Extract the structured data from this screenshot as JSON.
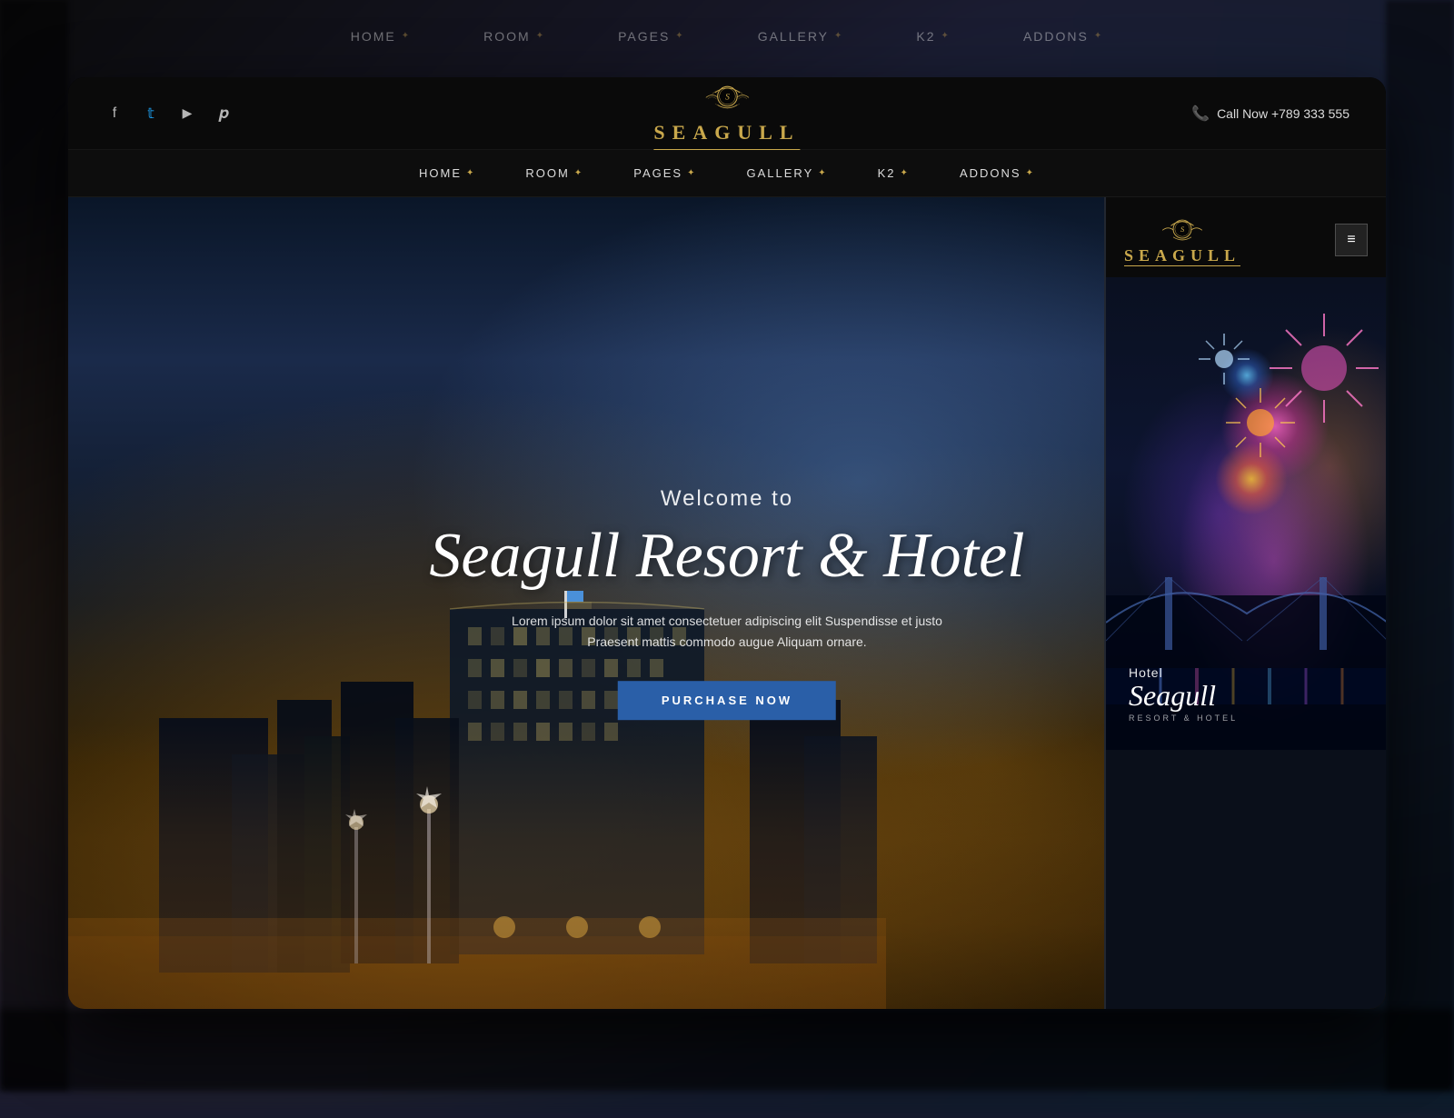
{
  "outer_nav": {
    "items": [
      {
        "label": "HOME",
        "icon": "✦",
        "id": "home"
      },
      {
        "label": "ROOM",
        "icon": "✦",
        "id": "room"
      },
      {
        "label": "PAGES",
        "icon": "✦",
        "id": "pages"
      },
      {
        "label": "GALLERY",
        "icon": "✦",
        "id": "gallery"
      },
      {
        "label": "K2",
        "icon": "✦",
        "id": "k2"
      },
      {
        "label": "ADDONS",
        "icon": "✦",
        "id": "addons"
      }
    ]
  },
  "header": {
    "logo_name": "SEAGULL",
    "logo_letter": "S",
    "call_label": "Call Now +789 333 555",
    "social": [
      {
        "name": "facebook",
        "icon": "f"
      },
      {
        "name": "twitter",
        "icon": "𝕥"
      },
      {
        "name": "youtube",
        "icon": "▶"
      },
      {
        "name": "pinterest",
        "icon": "𝒑"
      }
    ]
  },
  "nav": {
    "items": [
      {
        "label": "HOME",
        "icon": "✦"
      },
      {
        "label": "ROOM",
        "icon": "✦"
      },
      {
        "label": "PAGES",
        "icon": "✦"
      },
      {
        "label": "GALLERY",
        "icon": "✦"
      },
      {
        "label": "K2",
        "icon": "✦"
      },
      {
        "label": "ADDONS",
        "icon": "✦"
      }
    ]
  },
  "hero": {
    "welcome": "Welcome to",
    "title": "Seagull Resort & Hotel",
    "description": "Lorem ipsum dolor sit amet consectetuer adipiscing elit Suspendisse et justo Praesent mattis commodo augue Aliquam ornare.",
    "cta_label": "PURCHASE NOW"
  },
  "mobile": {
    "logo_name": "SEAGULL",
    "hotel_prefix": "Hotel",
    "hotel_name": "Seagull",
    "hotel_subtitle": "RESORT & HOTEL",
    "hamburger": "≡"
  }
}
